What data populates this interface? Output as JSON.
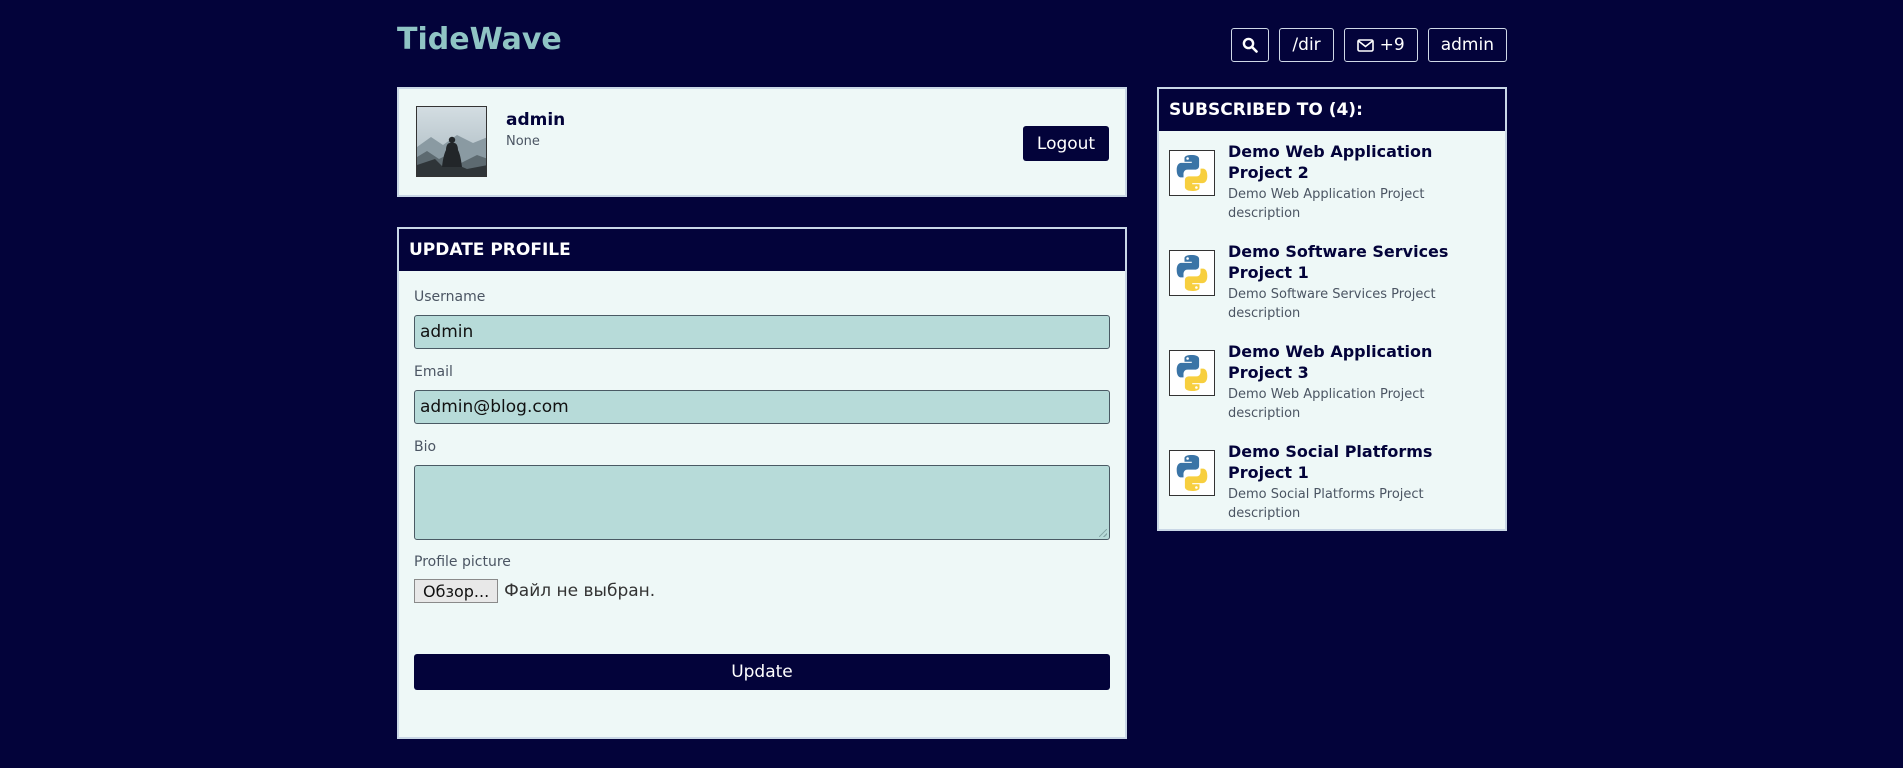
{
  "header": {
    "brand": "TideWave",
    "nav": {
      "dir_label": "/dir",
      "messages_label": "+9",
      "user_label": "admin"
    }
  },
  "profile": {
    "name": "admin",
    "bio": "None",
    "logout_label": "Logout"
  },
  "update_form": {
    "title": "UPDATE PROFILE",
    "username_label": "Username",
    "username_value": "admin",
    "email_label": "Email",
    "email_value": "admin@blog.com",
    "bio_label": "Bio",
    "bio_value": "",
    "picture_label": "Profile picture",
    "browse_label": "Обзор...",
    "no_file_text": "Файл не выбран.",
    "submit_label": "Update"
  },
  "subscriptions": {
    "title": "SUBSCRIBED TO (4):",
    "items": [
      {
        "title": "Demo Web Application Project 2",
        "description": "Demo Web Application Project description",
        "icon": "python-logo-icon"
      },
      {
        "title": "Demo Software Services Project 1",
        "description": "Demo Software Services Project description",
        "icon": "python-logo-icon"
      },
      {
        "title": "Demo Web Application Project 3",
        "description": "Demo Web Application Project description",
        "icon": "python-logo-icon"
      },
      {
        "title": "Demo Social Platforms Project 1",
        "description": "Demo Social Platforms Project description",
        "icon": "python-logo-icon"
      }
    ]
  },
  "colors": {
    "background": "#03033a",
    "brand": "#8fc4c4",
    "card": "#eef8f7",
    "input": "#b7dbd9"
  }
}
